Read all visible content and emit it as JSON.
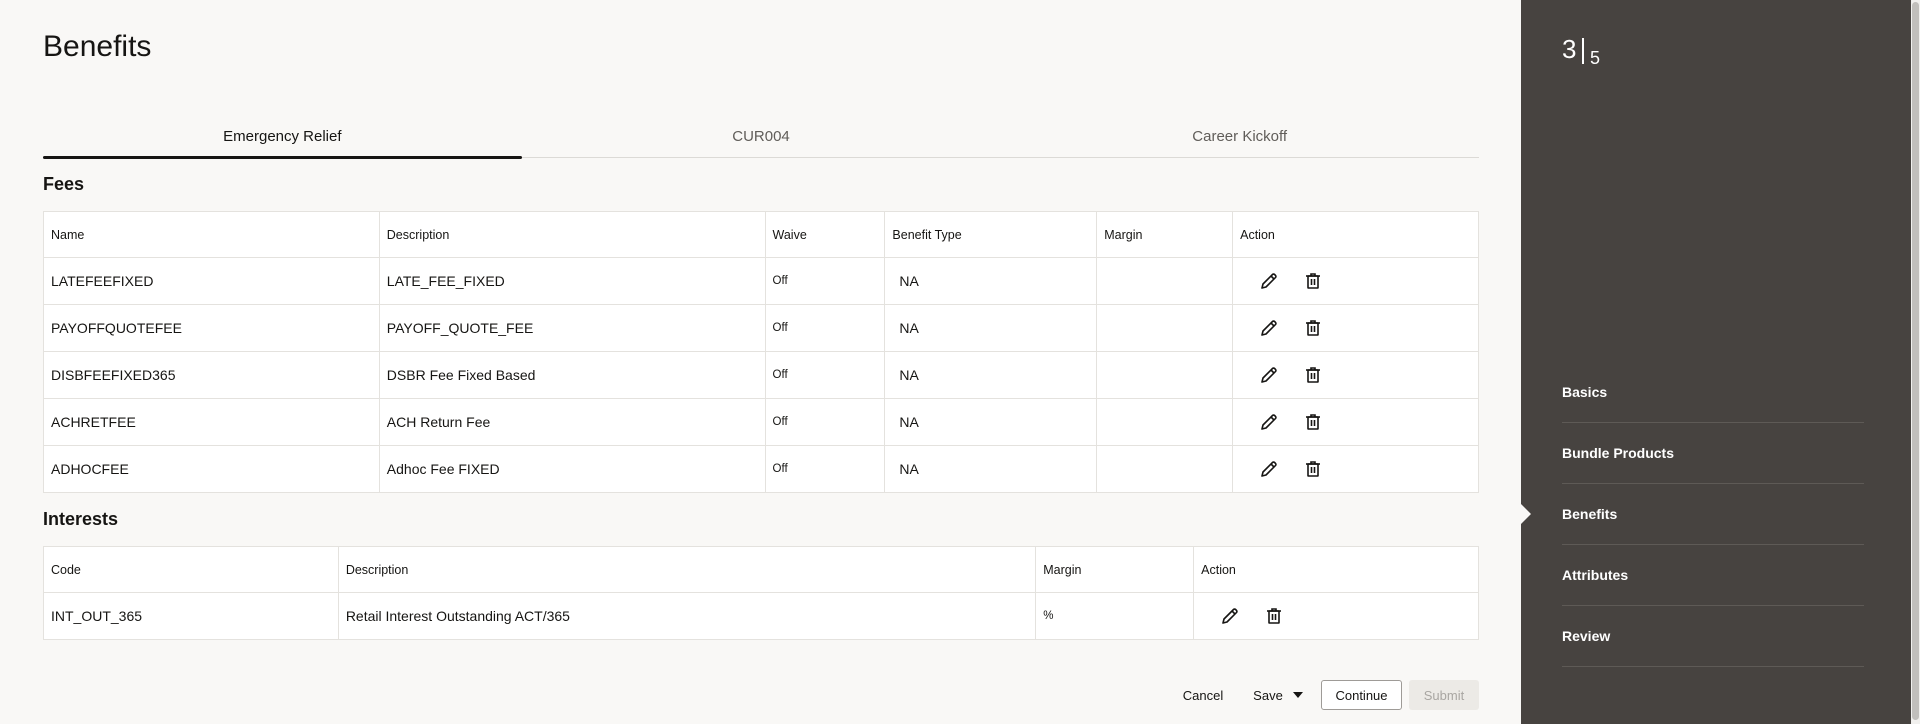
{
  "page": {
    "title": "Benefits"
  },
  "tabs": [
    {
      "label": "Emergency Relief",
      "active": true
    },
    {
      "label": "CUR004",
      "active": false
    },
    {
      "label": "Career Kickoff",
      "active": false
    }
  ],
  "fees": {
    "title": "Fees",
    "columns": [
      "Name",
      "Description",
      "Waive",
      "Benefit Type",
      "Margin",
      "Action"
    ],
    "rows": [
      {
        "name": "LATEFEEFIXED",
        "description": "LATE_FEE_FIXED",
        "waive": "Off",
        "benefit_type": "NA",
        "margin": ""
      },
      {
        "name": "PAYOFFQUOTEFEE",
        "description": "PAYOFF_QUOTE_FEE",
        "waive": "Off",
        "benefit_type": "NA",
        "margin": ""
      },
      {
        "name": "DISBFEEFIXED365",
        "description": "DSBR Fee Fixed Based",
        "waive": "Off",
        "benefit_type": "NA",
        "margin": ""
      },
      {
        "name": "ACHRETFEE",
        "description": "ACH Return Fee",
        "waive": "Off",
        "benefit_type": "NA",
        "margin": ""
      },
      {
        "name": "ADHOCFEE",
        "description": "Adhoc Fee FIXED",
        "waive": "Off",
        "benefit_type": "NA",
        "margin": ""
      }
    ]
  },
  "interests": {
    "title": "Interests",
    "columns": [
      "Code",
      "Description",
      "Margin",
      "Action"
    ],
    "rows": [
      {
        "code": "INT_OUT_365",
        "description": "Retail Interest Outstanding ACT/365",
        "margin": "%"
      }
    ]
  },
  "footer": {
    "cancel": "Cancel",
    "save": "Save",
    "continue": "Continue",
    "submit": "Submit"
  },
  "sidebar": {
    "current_step": "3",
    "total_steps": "5",
    "items": [
      {
        "label": "Basics",
        "active": false
      },
      {
        "label": "Bundle Products",
        "active": false
      },
      {
        "label": "Benefits",
        "active": true
      },
      {
        "label": "Attributes",
        "active": false
      },
      {
        "label": "Review",
        "active": false
      }
    ]
  },
  "icons": {
    "edit": "pencil-icon",
    "delete": "trash-icon"
  },
  "colors": {
    "sidebar_bg": "#474340",
    "page_bg": "#f9f8f6",
    "text": "#161513"
  }
}
